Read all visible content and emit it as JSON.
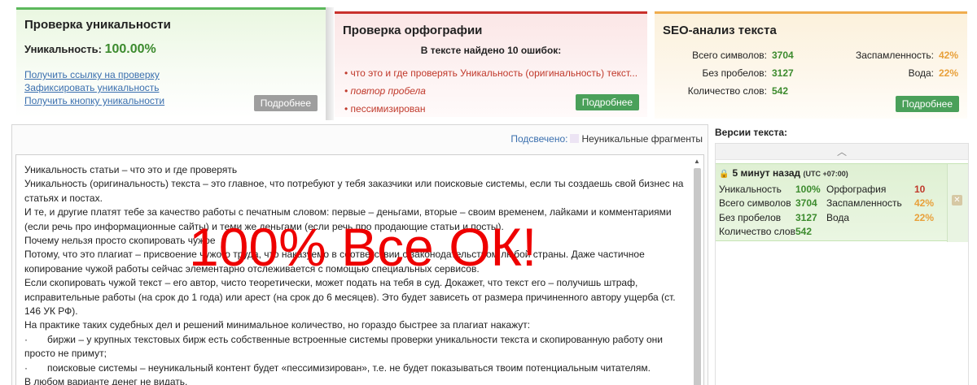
{
  "uniq": {
    "title": "Проверка уникальности",
    "label": "Уникальность:",
    "value": "100.00%",
    "links": [
      "Получить ссылку на проверку",
      "Зафиксировать уникальность",
      "Получить кнопку уникальности"
    ],
    "more": "Подробнее"
  },
  "spell": {
    "title": "Проверка орфографии",
    "count_text": "В тексте найдено 10 ошибок:",
    "errors": [
      "что это и где проверять Уникальность (оригинальность) текст...",
      "повтор пробела",
      "пессимизирован"
    ],
    "more": "Подробнее"
  },
  "seo": {
    "title": "SEO-анализ текста",
    "rows": [
      {
        "label": "Всего символов:",
        "value": "3704",
        "label2": "Заспамленность:",
        "value2": "42%"
      },
      {
        "label": "Без пробелов:",
        "value": "3127",
        "label2": "Вода:",
        "value2": "22%"
      },
      {
        "label": "Количество слов:",
        "value": "542",
        "label2": "",
        "value2": ""
      }
    ],
    "more": "Подробнее"
  },
  "legend": {
    "link": "Подсвечено:",
    "text": "Неуникальные фрагменты"
  },
  "editor": {
    "paragraphs": [
      "Уникальность статьи – что это и где проверять",
      "Уникальность (оригинальность) текста – это главное, что потребуют у тебя заказчики или поисковые системы, если ты создаешь свой бизнес на статьях и постах.",
      "И те, и другие платят тебе за качество работы с печатным словом: первые – деньгами, вторые – своим временем, лайками и комментариями (если речь про информационные сайты) и теми же деньгами (если речь про продающие статьи и посты).",
      "Почему нельзя просто скопировать чужое",
      "Потому, что это плагиат – присвоение чужого труда, что наказуемо в соответствии с законодательством любой страны. Даже частичное копирование чужой работы сейчас элементарно отслеживается с помощью специальных сервисов.",
      "Если скопировать чужой текст – его автор, чисто теоретически, может подать на тебя в суд. Докажет, что текст его – получишь штраф, исправительные работы (на срок до 1 года) или арест (на срок до 6 месяцев). Это будет зависеть от размера причиненного автору ущерба (ст. 146 УК РФ).",
      "На практике таких судебных дел и решений минимальное количество, но гораздо быстрее за плагиат накажут:"
    ],
    "bullets": [
      "биржи – у крупных текстовых бирж есть собственные встроенные системы проверки уникальности текста и скопированную работу они просто не примут;",
      "поисковые системы – неуникальный контент будет «пессимизирован», т.е. не будет показываться твоим потенциальным читателям."
    ],
    "last": "В любом варианте денег не видать.",
    "bullet_char": "·"
  },
  "overlay_text": "100% Все ОК!",
  "versions": {
    "title": "Версии текста:",
    "item": {
      "time": "5 минут назад",
      "tz": "(UTC +07:00)",
      "rows": [
        {
          "l1": "Уникальность",
          "v1": "100%",
          "l2": "Орфография",
          "v2": "10"
        },
        {
          "l1": "Всего символов",
          "v1": "3704",
          "l2": "Заспамленность",
          "v2": "42%"
        },
        {
          "l1": "Без пробелов",
          "v1": "3127",
          "l2": "Вода",
          "v2": "22%"
        },
        {
          "l1": "Количество слов",
          "v1": "542",
          "l2": "",
          "v2": ""
        }
      ]
    }
  },
  "colors": {
    "green": "#5cb85c",
    "red": "#c9302c",
    "orange": "#f0ad4e",
    "overlay": "#ee0000"
  }
}
